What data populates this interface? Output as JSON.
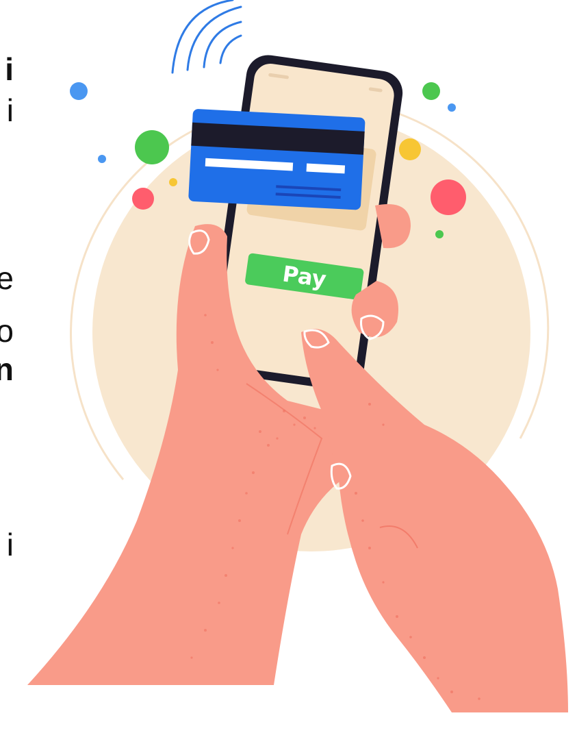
{
  "cut_off_text": [
    {
      "text": "i",
      "bold": true
    },
    {
      "text": "i",
      "bold": false
    },
    {
      "text": "e",
      "bold": false
    },
    {
      "text": "o",
      "bold": false
    },
    {
      "text": "n",
      "bold": true
    },
    {
      "text": "i",
      "bold": false
    }
  ],
  "phone": {
    "pay_button_label": "Pay"
  },
  "colors": {
    "backdrop_circle": "#f8e7cf",
    "phone_frame": "#1c1b2b",
    "phone_screen": "#f9e6cc",
    "card_blue": "#1f6fe8",
    "card_stripe": "#1c1b2b",
    "pay_green": "#4bcb5b",
    "skin": "#f99b89",
    "skin_shadow": "#ef6f5e",
    "nfc_waves": "#2f7be5",
    "dot_blue": "#4a97f1",
    "dot_green": "#4cc74f",
    "dot_red": "#ff5d6d",
    "dot_yellow": "#f7c634"
  }
}
